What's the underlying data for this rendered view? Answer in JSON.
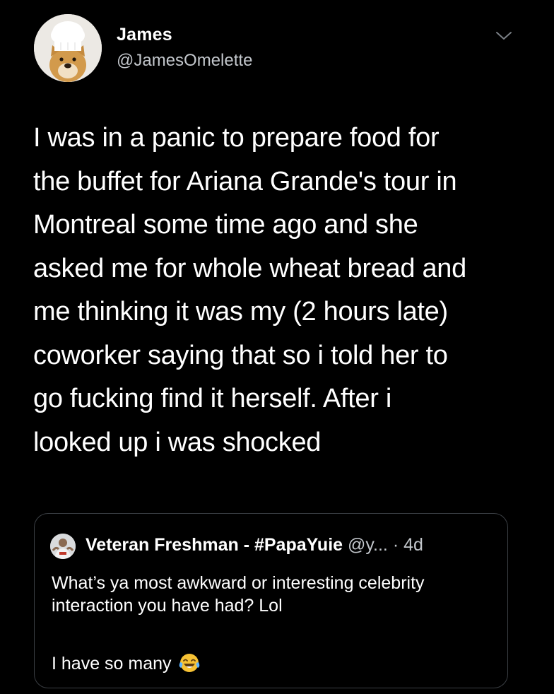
{
  "colors": {
    "background": "#000000",
    "text_primary": "#ffffff",
    "text_secondary": "#c3c7cc",
    "border": "#3b3f44"
  },
  "author": {
    "name": "James",
    "handle": "@JamesOmelette",
    "avatar_icon": "chef-dog-avatar"
  },
  "menu_icon": "chevron-down-icon",
  "tweet": {
    "text": "I was in a panic to prepare food for\nthe buffet for Ariana Grande's tour in\nMontreal some time ago and she\nasked me for whole wheat bread and\nme thinking it was my (2 hours late)\ncoworker saying that so i told her to\ngo fucking find it herself. After i\nlooked up i was shocked"
  },
  "quoted_tweet": {
    "avatar_icon": "user-avatar",
    "name": "Veteran Freshman - #PapaYuie",
    "handle": "@y...",
    "separator": "·",
    "time": "4d",
    "text": "What’s ya most awkward or interesting celebrity interaction you have had? Lol",
    "text2": "I have so many",
    "emoji_icon": "tears-of-joy-emoji"
  }
}
